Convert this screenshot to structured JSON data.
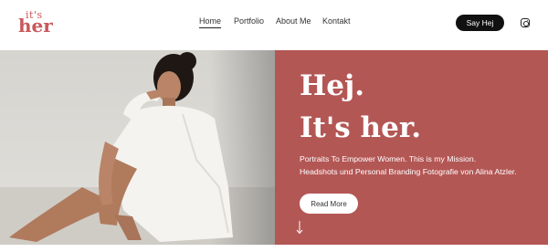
{
  "logo": {
    "line1": "it's",
    "line2": "her",
    "color": "#c9585c"
  },
  "nav": {
    "items": [
      {
        "label": "Home",
        "active": true
      },
      {
        "label": "Portfolio",
        "active": false
      },
      {
        "label": "About Me",
        "active": false
      },
      {
        "label": "Kontakt",
        "active": false
      }
    ]
  },
  "header": {
    "cta_label": "Say Hej",
    "social_icon": "instagram-icon"
  },
  "hero": {
    "title_line1": "Hej.",
    "title_line2": "It's her.",
    "text_line1": "Portraits To Empower Women. This is my Mission.",
    "text_line2": "Headshots und Personal Branding Fotografie von Alina Atzler.",
    "button_label": "Read More",
    "scroll_icon": "arrow-down-icon",
    "panel_color": "#b35755"
  },
  "colors": {
    "accent": "#b35755",
    "logo": "#c9585c",
    "button_dark": "#111111"
  }
}
